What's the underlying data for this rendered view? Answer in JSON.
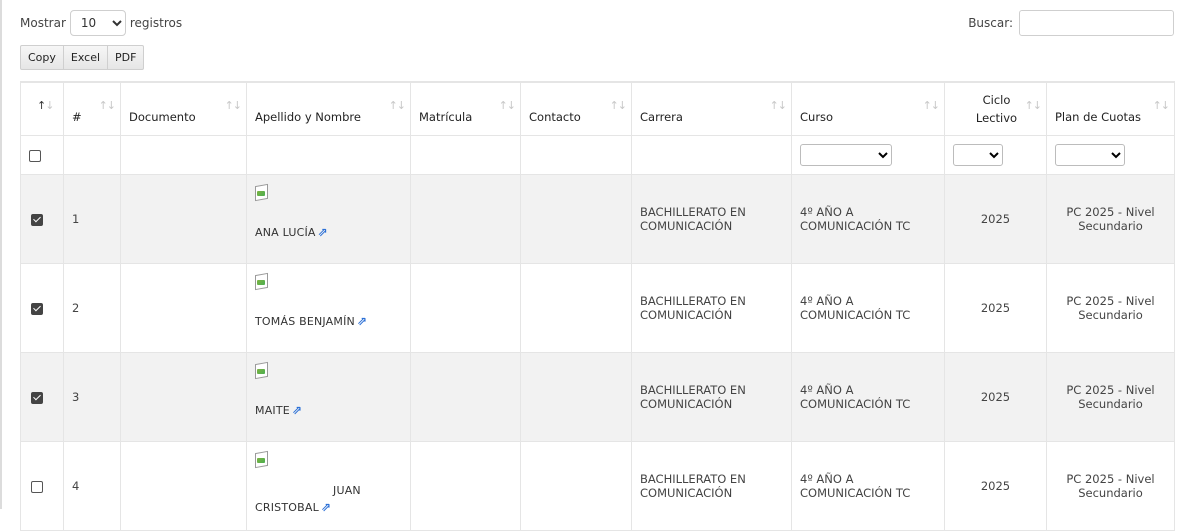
{
  "length_menu": {
    "prefix": "Mostrar",
    "value": "10",
    "suffix": "registros"
  },
  "search": {
    "label": "Buscar:",
    "value": ""
  },
  "buttons": {
    "copy": "Copy",
    "excel": "Excel",
    "pdf": "PDF"
  },
  "table": {
    "columns": {
      "num": "#",
      "documento": "Documento",
      "apellido": "Apellido y Nombre",
      "matricula": "Matrícula",
      "contacto": "Contacto",
      "carrera": "Carrera",
      "curso": "Curso",
      "ciclo_line1": "Ciclo",
      "ciclo_line2": "Lectivo",
      "plan": "Plan de Cuotas"
    },
    "rows": [
      {
        "checked": true,
        "num": "1",
        "documento": "",
        "nombre": "ANA LUCÍA",
        "matricula": "",
        "contacto": "",
        "carrera": "BACHILLERATO EN COMUNICACIÓN",
        "curso": "4º AÑO A COMUNICACIÓN TC",
        "ciclo": "2025",
        "plan": "PC 2025 - Nivel Secundario"
      },
      {
        "checked": true,
        "num": "2",
        "documento": "",
        "nombre": "TOMÁS BENJAMÍN",
        "matricula": "",
        "contacto": "",
        "carrera": "BACHILLERATO EN COMUNICACIÓN",
        "curso": "4º AÑO A COMUNICACIÓN TC",
        "ciclo": "2025",
        "plan": "PC 2025 - Nivel Secundario"
      },
      {
        "checked": true,
        "num": "3",
        "documento": "",
        "nombre": "MAITE",
        "matricula": "",
        "contacto": "",
        "carrera": "BACHILLERATO EN COMUNICACIÓN",
        "curso": "4º AÑO A COMUNICACIÓN TC",
        "ciclo": "2025",
        "plan": "PC 2025 - Nivel Secundario"
      },
      {
        "checked": false,
        "num": "4",
        "documento": "",
        "nombre_first": "JUAN",
        "nombre_second": "CRISTOBAL",
        "matricula": "",
        "contacto": "",
        "carrera": "BACHILLERATO EN COMUNICACIÓN",
        "curso": "4º AÑO A COMUNICACIÓN TC",
        "ciclo": "2025",
        "plan": "PC 2025 - Nivel Secundario"
      }
    ]
  },
  "icons": {
    "sort": "sort-arrows-icon",
    "external": "external-link-icon",
    "image": "broken-image-icon"
  },
  "colors": {
    "link_icon": "#2a6fd6",
    "stripe": "#f2f2f2",
    "border": "#e5e5e5"
  }
}
